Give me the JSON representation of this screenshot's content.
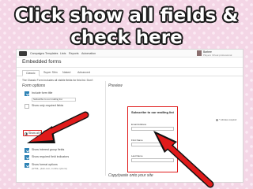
{
  "headline": {
    "line1": "Click show all fields &",
    "line2": "check here"
  },
  "nav": {
    "items": [
      "Campaigns",
      "Templates",
      "Lists",
      "Reports",
      "Automation"
    ],
    "user_name": "Barbee",
    "user_org": "Players Virtual professional"
  },
  "page": {
    "title": "Embedded forms",
    "tabs": [
      "Classic",
      "Super Slim",
      "Naked",
      "Advanced"
    ],
    "active_tab": "Classic",
    "intro": "The Classic Form includes all visible fields for this list. Don't",
    "form_options_heading": "Form options",
    "preview_heading": "Preview",
    "copy_heading": "Copy/paste onto your site"
  },
  "options": {
    "include_title": "Include form title",
    "title_value": "Subscribe to our mailing list",
    "show_required": "Show only required fields",
    "show_all": "Show all fields",
    "interest_groups": "Show interest group fields",
    "required_indicators": "Show required field indicators",
    "format_options": "Show format options",
    "format_options_sub": "(HTML, plain-text, mobile options)"
  },
  "preview_form": {
    "title": "Subscribe to our mailing list",
    "fields": [
      "Email Address",
      "First Name",
      "Last Name"
    ],
    "required_note": "* indicates required"
  },
  "colors": {
    "highlight": "#e01b1b",
    "checkbox": "#2f83b5",
    "background": "#f4d6e6"
  }
}
